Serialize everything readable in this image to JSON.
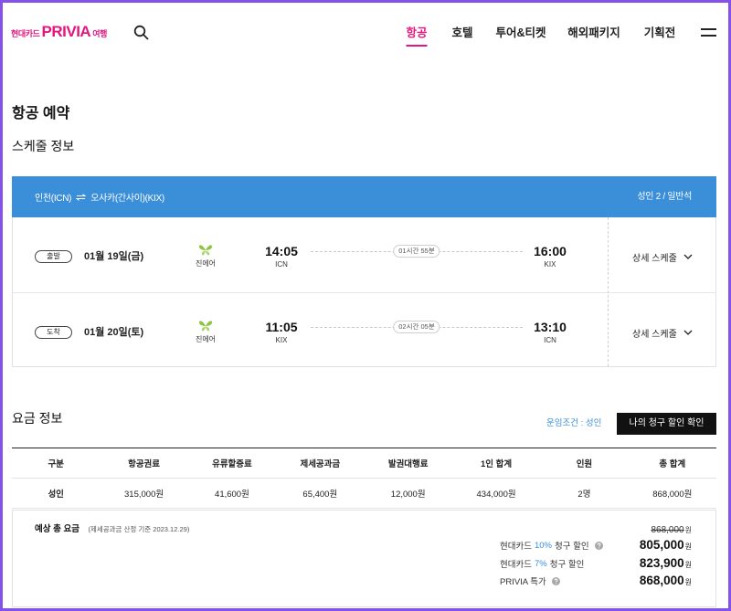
{
  "colors": {
    "brand_pink": "#e4157e",
    "accent_blue": "#3a8fd8",
    "airline_green": "#8cc63e",
    "frame_purple": "#8452e8"
  },
  "icons": {
    "search": "search-icon",
    "menu": "hamburger-menu-icon",
    "route_swap": "swap-arrows-icon",
    "airline": "airline-logo-icon",
    "expand": "chevron-down-icon",
    "help": "question-circle-icon"
  },
  "header": {
    "logo": {
      "prefix": "현대카드",
      "brand": "PRIVIA",
      "suffix": "여행"
    },
    "nav": [
      {
        "label": "항공",
        "active": true
      },
      {
        "label": "호텔",
        "active": false
      },
      {
        "label": "투어&티켓",
        "active": false
      },
      {
        "label": "해외패키지",
        "active": false
      },
      {
        "label": "기획전",
        "active": false
      }
    ]
  },
  "page": {
    "title": "항공 예약"
  },
  "schedule": {
    "title": "스케줄 정보",
    "route": {
      "from": "인천(ICN)",
      "to": "오사카(간사이)(KIX)"
    },
    "passengers": "성인 2 / 일반석",
    "flights": [
      {
        "direction": "출발",
        "date": "01월 19일(금)",
        "airline": "진에어",
        "departure_time": "14:05",
        "departure_airport": "ICN",
        "duration": "01시간 55분",
        "arrival_time": "16:00",
        "arrival_airport": "KIX",
        "detail_label": "상세 스케줄"
      },
      {
        "direction": "도착",
        "date": "01월 20일(토)",
        "airline": "진에어",
        "departure_time": "11:05",
        "departure_airport": "KIX",
        "duration": "02시간 05분",
        "arrival_time": "13:10",
        "arrival_airport": "ICN",
        "detail_label": "상세 스케줄"
      }
    ]
  },
  "fare": {
    "title": "요금 정보",
    "condition": "운임조건 : 성인",
    "discount_check_button": "나의 청구 할인 확인",
    "table": {
      "headers": [
        "구분",
        "항공권료",
        "유류할증료",
        "제세공과금",
        "발권대행료",
        "1인 합계",
        "인원",
        "총 합계"
      ],
      "rows": [
        [
          "성인",
          "315,000원",
          "41,600원",
          "65,400원",
          "12,000원",
          "434,000원",
          "2명",
          "868,000원"
        ]
      ]
    },
    "summary": {
      "label": "예상 총 요금",
      "note": "(제세공과금 산정 기준 2023.12.29)",
      "original_amount": "868,000",
      "currency": "원",
      "discounts": [
        {
          "card": "현대카드",
          "rate": "10%",
          "label": "청구 할인",
          "amount": "805,000"
        },
        {
          "card": "현대카드",
          "rate": "7%",
          "label": "청구 할인",
          "amount": "823,900"
        },
        {
          "label": "PRIVIA 특가",
          "amount": "868,000"
        }
      ]
    }
  }
}
